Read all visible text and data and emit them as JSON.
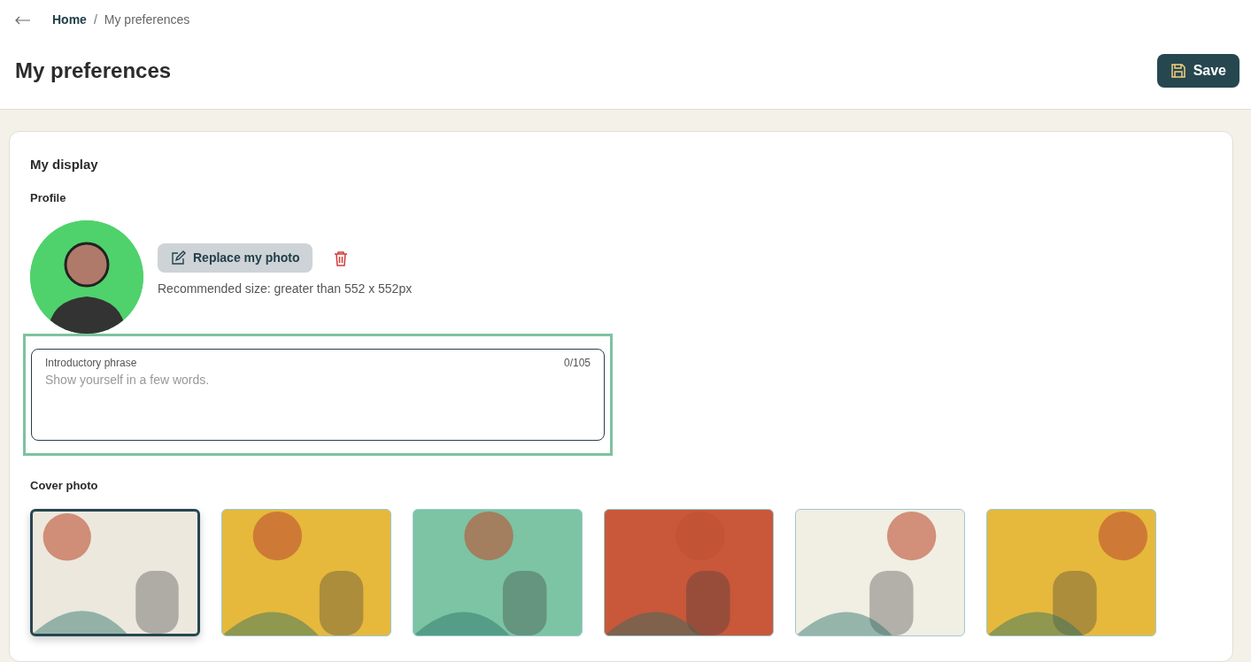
{
  "breadcrumb": [
    {
      "label": "Home",
      "current": false
    },
    {
      "label": "My preferences",
      "current": true
    }
  ],
  "breadcrumb_separator": "/",
  "title": "My preferences",
  "save_button": "Save",
  "section_title": "My display",
  "profile": {
    "heading": "Profile",
    "replace_button": "Replace my photo",
    "hint": "Recommended size: greater than 552 x 552px"
  },
  "intro_field": {
    "label": "Introductory phrase",
    "counter": "0/105",
    "placeholder": "Show yourself in a few words.",
    "focused": true
  },
  "cover": {
    "heading": "Cover photo",
    "photos": [
      {
        "selected": true,
        "color": "#ece8de"
      },
      {
        "selected": false,
        "color": "#e6b93c"
      },
      {
        "selected": false,
        "color": "#7cc4a4"
      },
      {
        "selected": false,
        "color": "#c9573a"
      },
      {
        "selected": false,
        "color": "#f1eee4"
      },
      {
        "selected": false,
        "color": "#e6b93c"
      }
    ]
  }
}
